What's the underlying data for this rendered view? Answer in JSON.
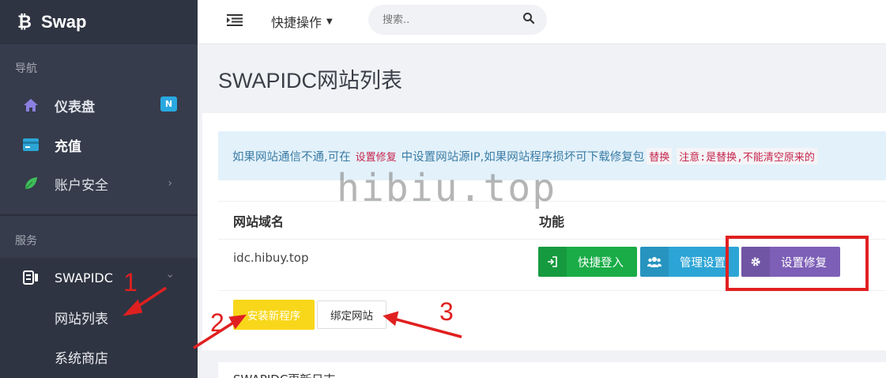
{
  "brand": {
    "name": "Swap",
    "icon": "bitcoin-icon"
  },
  "sidebar": {
    "nav_label": "导航",
    "services_label": "服务",
    "items": [
      {
        "label": "仪表盘",
        "icon": "home-icon",
        "badge": "N"
      },
      {
        "label": "充值",
        "icon": "card-icon"
      },
      {
        "label": "账户安全",
        "icon": "leaf-icon"
      }
    ],
    "swapidc": {
      "label": "SWAPIDC",
      "icon": "server-icon"
    },
    "sub_items": [
      {
        "label": "网站列表"
      },
      {
        "label": "系统商店"
      }
    ]
  },
  "topbar": {
    "quick_ops": "快捷操作",
    "search_placeholder": "搜索.."
  },
  "page": {
    "title": "SWAPIDC网站列表"
  },
  "alert": {
    "part1": "如果网站通信不通,可在",
    "code1": "设置修复",
    "part2": "中设置网站源IP,如果网站程序损坏可下载修复包",
    "code2": "替换",
    "code3": "注意:是替换,不能清空原来的"
  },
  "watermark": "hibiu.top",
  "table": {
    "headers": [
      "网站域名",
      "功能"
    ],
    "rows": [
      {
        "domain": "idc.hibuy.top"
      }
    ],
    "actions": {
      "login": "快捷登入",
      "manage": "管理设置",
      "repair": "设置修复"
    }
  },
  "buttons": {
    "install": "安装新程序",
    "bind": "绑定网站"
  },
  "panel2": {
    "title": "SWAPIDC更新日志"
  },
  "annotations": [
    "1",
    "2",
    "3"
  ],
  "colors": {
    "sidebar": "#363c4b",
    "green": "#19ac47",
    "blue": "#2ca5d6",
    "purple": "#7d5fb7",
    "yellow": "#f8d71a",
    "annotation": "#e02020"
  }
}
